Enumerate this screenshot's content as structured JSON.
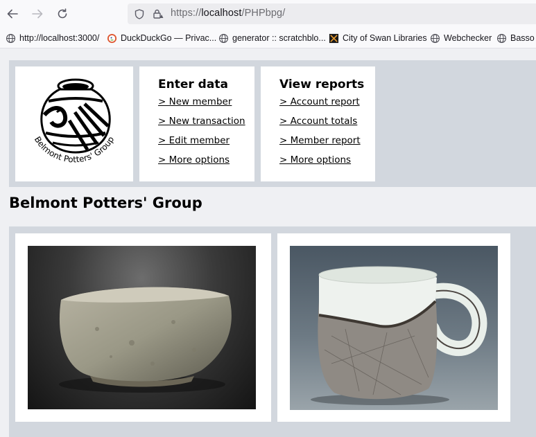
{
  "browser": {
    "url_prefix": "https://",
    "url_host": "localhost",
    "url_path": "/PHPbpg/",
    "bookmarks": [
      {
        "label": "http://localhost:3000/",
        "icon": "globe-icon"
      },
      {
        "label": "DuckDuckGo — Privac...",
        "icon": "duckduckgo-icon"
      },
      {
        "label": "generator :: scratchblo...",
        "icon": "globe-icon"
      },
      {
        "label": "City of Swan Libraries",
        "icon": "library-icon"
      },
      {
        "label": "Webchecker",
        "icon": "globe-icon"
      },
      {
        "label": "Basso I",
        "icon": "globe-icon"
      }
    ]
  },
  "logo": {
    "text": "Belmont Potters' Group"
  },
  "enter_menu": {
    "title": "Enter data",
    "links": [
      "> New member",
      "> New transaction",
      "> Edit member",
      "> More options"
    ]
  },
  "view_menu": {
    "title": "View reports",
    "links": [
      "> Account report",
      "> Account totals",
      "> Member report",
      "> More options"
    ]
  },
  "page": {
    "title": "Belmont Potters' Group"
  },
  "photos": [
    {
      "subject": "textured stoneware bowl"
    },
    {
      "subject": "white glazed mug with loop handle"
    }
  ],
  "colors": {
    "page_bg": "#eff0f3",
    "band_bg": "#d2d7de",
    "card_bg": "#ffffff"
  }
}
